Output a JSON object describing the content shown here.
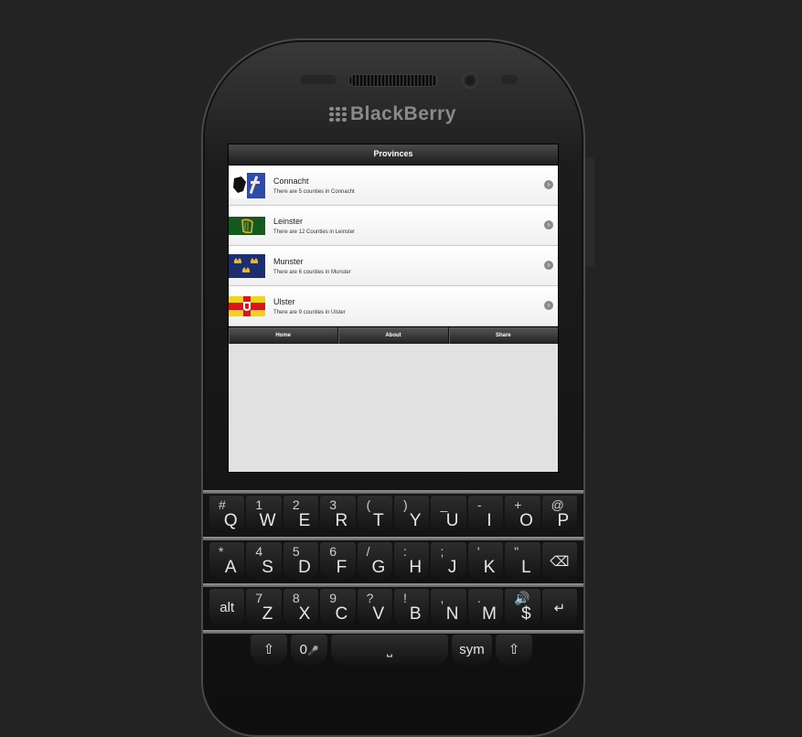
{
  "device": {
    "brand": "BlackBerry"
  },
  "app": {
    "header_title": "Provinces",
    "provinces": [
      {
        "name": "Connacht",
        "description": "There are 5 counties in Connacht",
        "flag": "connacht-flag"
      },
      {
        "name": "Leinster",
        "description": "There are 12 Counties in Leinster",
        "flag": "leinster-flag"
      },
      {
        "name": "Munster",
        "description": "There are 6 counties in Munster",
        "flag": "munster-flag"
      },
      {
        "name": "Ulster",
        "description": "There are 9 counties in Ulster",
        "flag": "ulster-flag"
      }
    ],
    "nav": {
      "home": "Home",
      "about": "About",
      "share": "Share"
    }
  },
  "keyboard": {
    "row1": [
      [
        "#",
        "Q"
      ],
      [
        "1",
        "W"
      ],
      [
        "2",
        "E"
      ],
      [
        "3",
        "R"
      ],
      [
        "(",
        "T"
      ],
      [
        ")",
        "Y"
      ],
      [
        "_",
        "U"
      ],
      [
        "-",
        "I"
      ],
      [
        "+",
        "O"
      ],
      [
        "@",
        "P"
      ]
    ],
    "row2": [
      [
        "*",
        "A"
      ],
      [
        "4",
        "S"
      ],
      [
        "5",
        "D"
      ],
      [
        "6",
        "F"
      ],
      [
        "/",
        "G"
      ],
      [
        ":",
        "H"
      ],
      [
        ";",
        "J"
      ],
      [
        "'",
        "K"
      ],
      [
        "\"",
        "L"
      ],
      [
        "",
        "⌫"
      ]
    ],
    "row3": [
      [
        "",
        "alt"
      ],
      [
        "7",
        "Z"
      ],
      [
        "8",
        "X"
      ],
      [
        "9",
        "C"
      ],
      [
        "?",
        "V"
      ],
      [
        "!",
        "B"
      ],
      [
        ",",
        "N"
      ],
      [
        ".",
        "M"
      ],
      [
        "🔊",
        "$"
      ],
      [
        "",
        "↵"
      ]
    ],
    "row4": {
      "shift_left": "⇧",
      "zero": "0",
      "mic": "🎤",
      "space": "⎵",
      "sym": "sym",
      "shift_right": "⇧"
    }
  },
  "colors": {
    "screen_bg": "#e1e1e1",
    "header_bg": "#2a2a2a",
    "device_bg": "#1a1a1a"
  }
}
